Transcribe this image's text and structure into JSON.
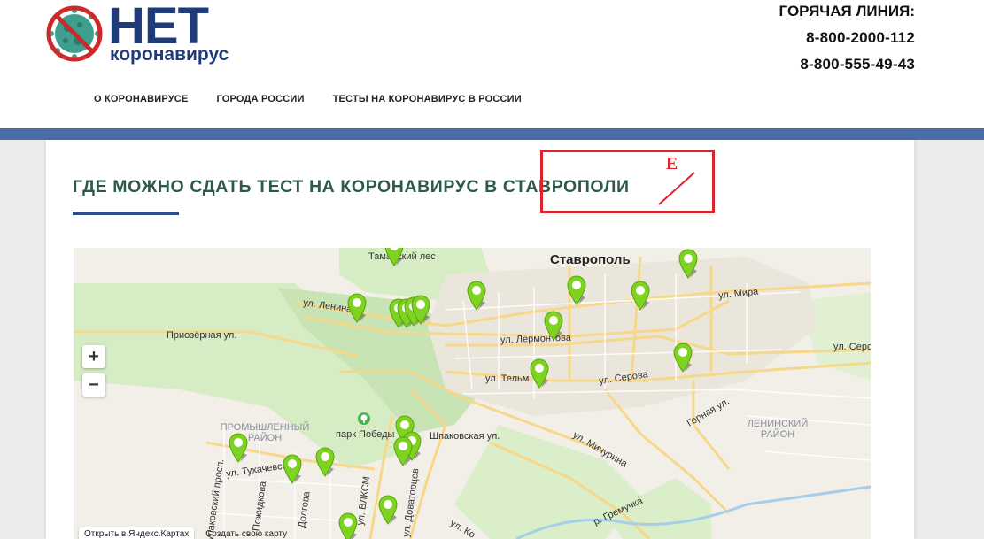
{
  "header": {
    "logo_big": "НЕТ",
    "logo_small": "коронавирус",
    "hotline_title": "ГОРЯЧАЯ ЛИНИЯ:",
    "phones": [
      "8-800-2000-112",
      "8-800-555-49-43"
    ]
  },
  "nav": {
    "items": [
      "О КОРОНАВИРУСЕ",
      "ГОРОДА РОССИИ",
      "ТЕСТЫ НА КОРОНАВИРУС В РОССИИ"
    ]
  },
  "main": {
    "title": "ГДЕ МОЖНО СДАТЬ ТЕСТ НА КОРОНАВИРУС В СТАВРОПОЛИ",
    "annotation_letter": "Е"
  },
  "colors": {
    "brand_blue": "#1f3b7a",
    "accent_blue": "#4a6fa5",
    "title_green": "#2d5a4a",
    "annotation_red": "#d9232d",
    "pin_green": "#7ed321"
  },
  "map": {
    "labels": {
      "forest": "Таманский лес",
      "city": "Ставрополь",
      "lenina": "ул. Ленина",
      "mira": "ул. Мира",
      "priozernaya": "Приозёрная ул.",
      "lermontova": "ул. Лермонтова",
      "serova_right": "ул. Серо",
      "telman": "ул. Тельм",
      "serova": "ул. Серова",
      "gornaya": "Горная ул.",
      "prom_district": "ПРОМЫШЛЕННЫЙ\nРАЙОН",
      "len_district": "ЛЕНИНСКИЙ\nРАЙОН",
      "park": "парк Победы",
      "shpakovskaya": "Шпаковская ул.",
      "michurina": "ул. Мичурина",
      "tukhachevskogo": "ул. Тухачевского",
      "gremyachka": "р. Гремучка",
      "vlksm": "ул. ВЛКСМ",
      "dovatortsev": "ул. Доваторцев",
      "kosm_prosp": "Кулаковский просп.",
      "pozhidkova": "Пожидкова",
      "dolgova": "Долгова",
      "ko": "ул. Ко"
    },
    "zoom_in": "+",
    "zoom_out": "−",
    "open_in_yandex": "Открыть в Яндекс.Картах",
    "create_map": "Создать свою карту"
  }
}
